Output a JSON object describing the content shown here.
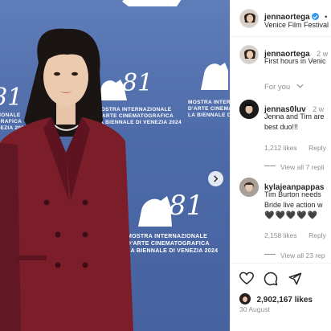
{
  "photo": {
    "backdrop_text": {
      "line1": "MOSTRA INTERNAZIONALE",
      "line2": "D'ARTE CINEMATOGRAFICA",
      "line3": "LA BIENNALE DI VENEZIA 2024",
      "partial_line1": "NTERNAZIONALE",
      "partial_line2": "NEMATOGRAFICA",
      "partial_line3": "LE DI VENEZIA 2024",
      "number": "81"
    },
    "colors": {
      "backdrop": "#4d6aa8",
      "suit": "#7b1e2a",
      "hair": "#1a1412"
    }
  },
  "header": {
    "username": "jennaortega",
    "location": "Venice Film Festival",
    "follow_dot": "•"
  },
  "caption": {
    "username": "jennaortega",
    "time": "2 w",
    "text": "First hours in Venic"
  },
  "for_you": "For you",
  "comments": [
    {
      "username": "jennas0luv",
      "time": "2 w",
      "line1": "Jenna and Tim are",
      "line2": "best duo!!!",
      "likes": "1,212 likes",
      "reply": "Reply",
      "view_replies": "View all 7 repli"
    },
    {
      "username": "kylajeanpappas",
      "time": "2",
      "line1": "Tim Burton needs",
      "line2": "Bride live action w",
      "hearts": "🖤🖤🖤🖤🖤",
      "likes": "2,158 likes",
      "reply": "Reply",
      "view_replies": "View all 23 rep"
    }
  ],
  "footer": {
    "likes": "2,902,167 likes",
    "date": "30 August"
  }
}
